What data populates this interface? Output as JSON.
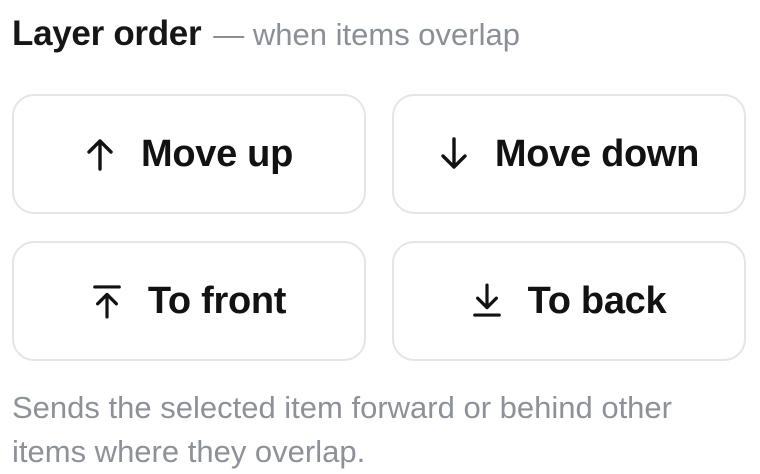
{
  "section": {
    "title": "Layer order",
    "subtitle": "— when items overlap"
  },
  "buttons": {
    "move_up": {
      "label": "Move up",
      "icon": "arrow-up-icon"
    },
    "move_down": {
      "label": "Move down",
      "icon": "arrow-down-icon"
    },
    "to_front": {
      "label": "To front",
      "icon": "bring-to-front-icon"
    },
    "to_back": {
      "label": "To back",
      "icon": "send-to-back-icon"
    }
  },
  "help_text": "Sends the selected item forward or behind other items where they overlap.",
  "colors": {
    "text": "#121212",
    "muted": "#8d929a",
    "border": "#e3e5e9",
    "background": "#ffffff"
  }
}
